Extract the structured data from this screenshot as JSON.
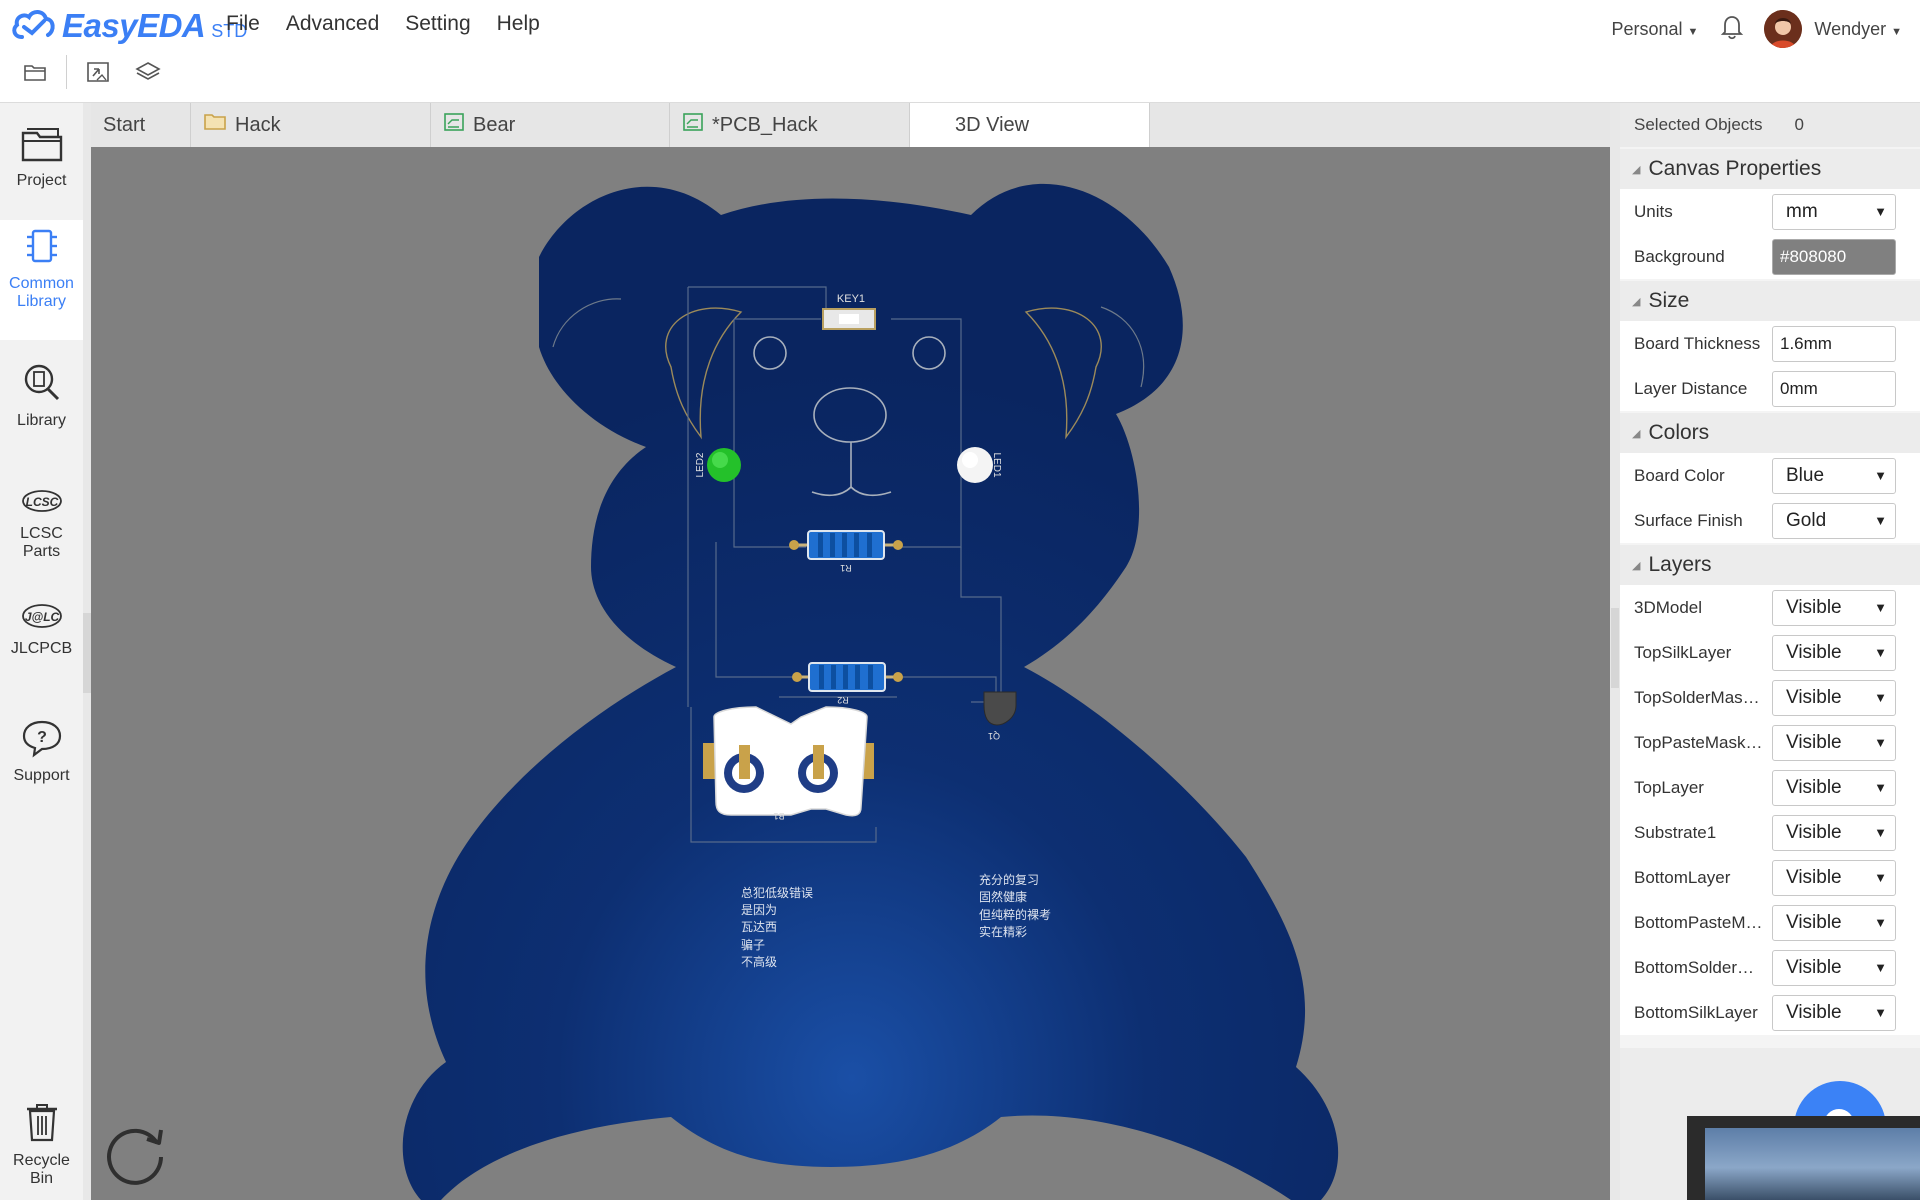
{
  "app": {
    "logo_text": "EasyEDA",
    "logo_suffix": "STD",
    "brand_color": "#3b7ff5"
  },
  "menu": [
    "File",
    "Advanced",
    "Setting",
    "Help"
  ],
  "account": {
    "workspace": "Personal",
    "username": "Wendyer"
  },
  "toolbar": {
    "icons": [
      "folder-icon",
      "import-icon",
      "layers-icon"
    ]
  },
  "sidebar": {
    "items": [
      {
        "label": "Project",
        "icon": "folder-icon"
      },
      {
        "label": "Common Library",
        "icon": "chip-icon"
      },
      {
        "label": "Library",
        "icon": "search-chip-icon"
      },
      {
        "label": "LCSC Parts",
        "icon": "lcsc-logo-icon"
      },
      {
        "label": "JLCPCB",
        "icon": "jlc-logo-icon"
      },
      {
        "label": "Support",
        "icon": "question-icon"
      },
      {
        "label": "Recycle Bin",
        "icon": "trash-icon"
      }
    ]
  },
  "tabs": [
    {
      "label": "Start",
      "icon": ""
    },
    {
      "label": "Hack",
      "icon": "folder-icon"
    },
    {
      "label": "Bear",
      "icon": "pcb-icon"
    },
    {
      "label": "*PCB_Hack",
      "icon": "pcb-icon"
    },
    {
      "label": "3D View",
      "icon": "",
      "active": true
    }
  ],
  "canvas": {
    "background": "#808080",
    "board_color": "#0d2d6b",
    "silkscreen": {
      "key": "KEY1",
      "led2": "LED2",
      "led1": "LED1",
      "r1": "R1",
      "r2": "R2",
      "q1": "Q1",
      "b1": "B1",
      "text_left": [
        "总犯低级错误",
        "是因为",
        "瓦达西",
        "骗子",
        "不高级"
      ],
      "text_right": [
        "充分的复习",
        "固然健康",
        "但纯粹的裸考",
        "实在精彩"
      ]
    }
  },
  "panel": {
    "selected_label": "Selected Objects",
    "selected_count": "0",
    "sections": {
      "canvas": "Canvas Properties",
      "size": "Size",
      "colors": "Colors",
      "layers": "Layers"
    },
    "canvas_props": [
      {
        "label": "Units",
        "value": "mm"
      },
      {
        "label": "Background",
        "value": "#808080"
      }
    ],
    "size_props": [
      {
        "label": "Board Thickness",
        "value": "1.6mm"
      },
      {
        "label": "Layer Distance",
        "value": "0mm"
      }
    ],
    "color_props": [
      {
        "label": "Board Color",
        "value": "Blue"
      },
      {
        "label": "Surface Finish",
        "value": "Gold"
      }
    ],
    "layers": [
      {
        "label": "3DModel",
        "value": "Visible"
      },
      {
        "label": "TopSilkLayer",
        "value": "Visible"
      },
      {
        "label": "TopSolderMaskLayer",
        "value": "Visible"
      },
      {
        "label": "TopPasteMaskLayer",
        "value": "Visible"
      },
      {
        "label": "TopLayer",
        "value": "Visible"
      },
      {
        "label": "Substrate1",
        "value": "Visible"
      },
      {
        "label": "BottomLayer",
        "value": "Visible"
      },
      {
        "label": "BottomPasteMaskLayer",
        "value": "Visible"
      },
      {
        "label": "BottomSolderMaskLayer",
        "value": "Visible"
      },
      {
        "label": "BottomSilkLayer",
        "value": "Visible"
      }
    ]
  }
}
